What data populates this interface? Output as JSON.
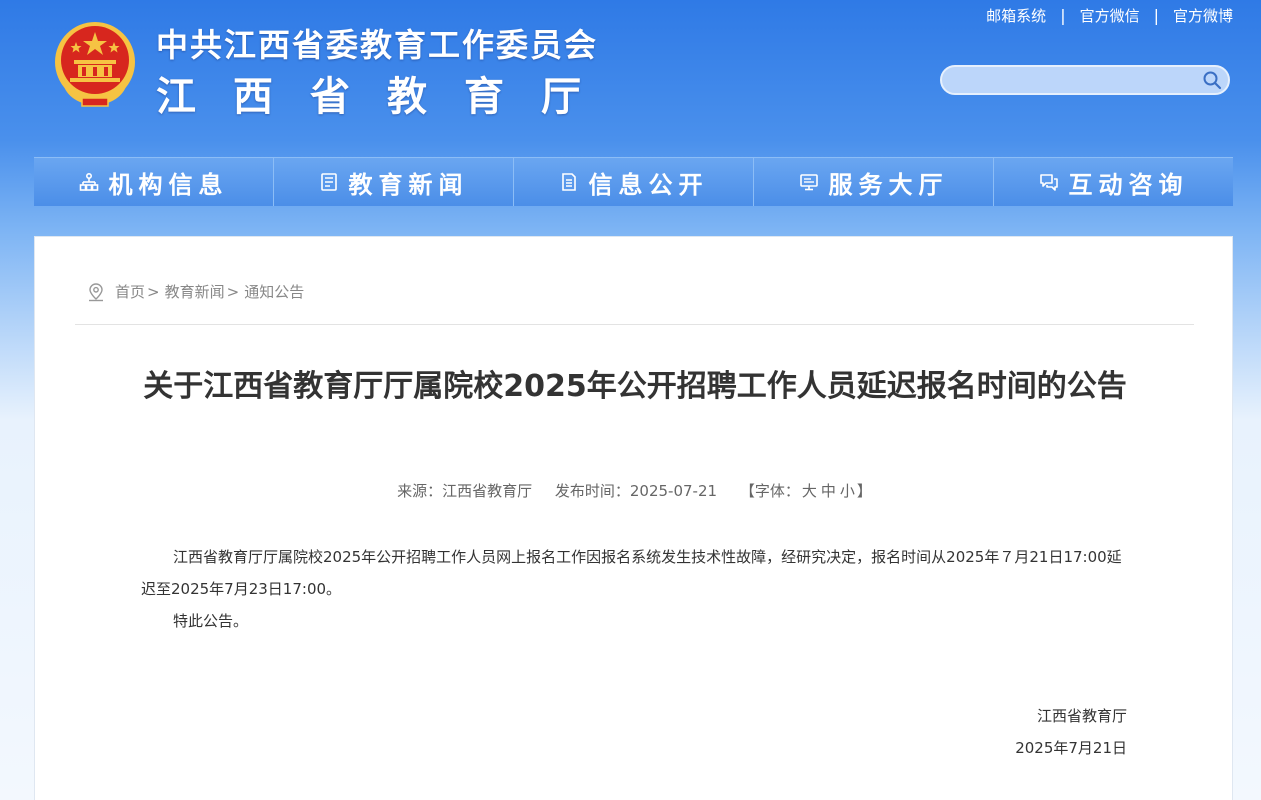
{
  "header": {
    "title_line1": "中共江西省委教育工作委员会",
    "title_line2": "江西省教育厅",
    "emblem_icon": "national-emblem-icon"
  },
  "toplinks": [
    {
      "label": "邮箱系统"
    },
    {
      "label": "官方微信"
    },
    {
      "label": "官方微博"
    }
  ],
  "search": {
    "placeholder": "",
    "icon": "search-icon"
  },
  "nav": [
    {
      "label": "机构信息",
      "icon": "org-chart-icon"
    },
    {
      "label": "教育新闻",
      "icon": "news-icon"
    },
    {
      "label": "信息公开",
      "icon": "document-icon"
    },
    {
      "label": "服务大厅",
      "icon": "monitor-icon"
    },
    {
      "label": "互动咨询",
      "icon": "chat-icon"
    }
  ],
  "breadcrumb": {
    "icon": "location-pin-icon",
    "items": [
      "首页",
      "教育新闻",
      "通知公告"
    ]
  },
  "article": {
    "title": "关于江西省教育厅厅属院校2025年公开招聘工作人员延迟报名时间的公告",
    "source": "来源：江西省教育厅",
    "date": "发布时间：2025-07-21",
    "fontsize_prefix": "【字体：",
    "fontsize_large": "大",
    "fontsize_medium": "中",
    "fontsize_small": "小",
    "fontsize_suffix": "】",
    "paragraphs": [
      "江西省教育厅厅属院校2025年公开招聘工作人员网上报名工作因报名系统发生技术性故障，经研究决定，报名时间从2025年７月21日17:00延迟至2025年7月23日17:00。",
      "特此公告。"
    ],
    "sign_org": "江西省教育厅",
    "sign_date": "2025年7月21日"
  },
  "colors": {
    "header_blue": "#2f7ae6",
    "nav_blue": "#4b8ee8",
    "emblem_red": "#d7261e",
    "emblem_gold": "#f6c343"
  }
}
